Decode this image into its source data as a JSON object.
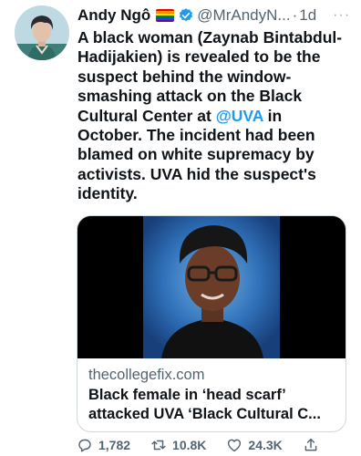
{
  "tweet": {
    "author": {
      "display_name": "Andy Ngô",
      "handle": "@MrAndyN...",
      "separator": "·",
      "time": "1d",
      "flag_icon": "rainbow-flag-icon",
      "verified_icon": "verified-badge-icon",
      "verified_color": "#1d9bf0"
    },
    "more_label": "···",
    "text": {
      "part1": "A black woman (Zaynab Bintabdul-Hadijakien) is revealed to be the suspect behind the window-smashing attack on the Black Cultural Center at ",
      "mention": "@UVA",
      "part2": " in October. The incident had been blamed on white supremacy by activists. UVA hid the suspect's identity."
    },
    "card": {
      "domain": "thecollegefix.com",
      "title": "Black female in ‘head scarf’ attacked UVA ‘Black Cultural C...",
      "image_icon": "portrait-photo"
    },
    "actions": {
      "replies": "1,782",
      "retweets": "10.8K",
      "likes": "24.3K"
    },
    "colors": {
      "text": "#0f1419",
      "secondary": "#536471",
      "link": "#1d9bf0"
    }
  }
}
